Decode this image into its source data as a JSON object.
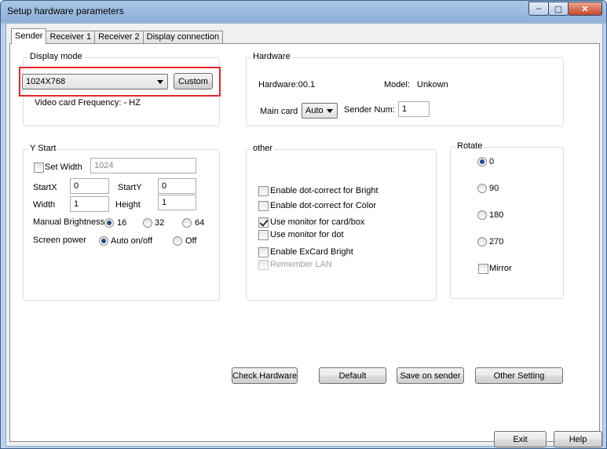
{
  "window": {
    "title": "Setup hardware parameters",
    "minimize": "–",
    "maximize": "▢",
    "close": "✕"
  },
  "tabs": [
    "Sender",
    "Receiver 1",
    "Receiver 2",
    "Display connection"
  ],
  "display_mode": {
    "label": "Display mode",
    "resolution": "1024X768",
    "custom_button": "Custom",
    "video_card_frequency": "Video card Frequency: - HZ"
  },
  "hardware": {
    "label": "Hardware",
    "hardware_text": "Hardware:00.1",
    "model_label": "Model:",
    "model_value": "Unkown",
    "main_card_label": "Main card",
    "main_card_value": "Auto",
    "sender_num_label": "Sender Num:",
    "sender_num_value": "1"
  },
  "y_start": {
    "label": "Y Start",
    "set_width_label": "Set Width",
    "set_width_value": "1024",
    "startx_label": "StartX",
    "startx_value": "0",
    "starty_label": "StartY",
    "starty_value": "0",
    "width_label": "Width",
    "width_value": "1",
    "height_label": "Height",
    "height_value": "1",
    "manual_brightness_label": "Manual Brightness",
    "brightness_options": [
      "16",
      "32",
      "64"
    ],
    "brightness_selected": "16",
    "screen_power_label": "Screen power",
    "power_options": [
      "Auto on/off",
      "Off"
    ],
    "power_selected": "Auto on/off"
  },
  "other": {
    "label": "other",
    "options": [
      {
        "label": "Enable dot-correct for Bright",
        "checked": false,
        "disabled": false
      },
      {
        "label": "Enable dot-correct for Color",
        "checked": false,
        "disabled": false
      },
      {
        "label": "Use monitor for card/box",
        "checked": true,
        "disabled": false
      },
      {
        "label": "Use monitor for dot",
        "checked": false,
        "disabled": false
      },
      {
        "label": "Enable ExCard Bright",
        "checked": false,
        "disabled": false
      },
      {
        "label": "Remember LAN",
        "checked": false,
        "disabled": true
      }
    ]
  },
  "rotate": {
    "label": "Rotate",
    "options": [
      "0",
      "90",
      "180",
      "270"
    ],
    "selected": "0",
    "mirror_label": "Mirror"
  },
  "actions": {
    "check_hardware": "Check Hardware",
    "default": "Default",
    "save_on_sender": "Save on sender",
    "other_setting": "Other Setting"
  },
  "footer": {
    "exit": "Exit",
    "help": "Help"
  },
  "colors": {
    "highlight_box": "#e8262b",
    "title_bar": "#a9c6e6"
  }
}
